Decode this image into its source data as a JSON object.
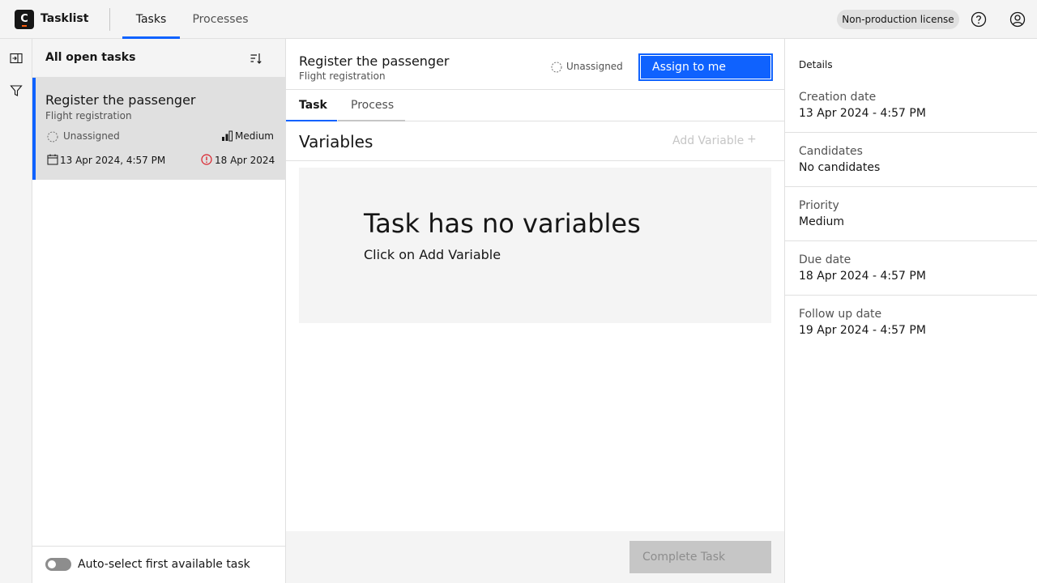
{
  "header": {
    "logo_letter": "C",
    "app_title": "Tasklist",
    "nav": [
      "Tasks",
      "Processes"
    ],
    "license": "Non-production license",
    "accent_color": "#0f62fe"
  },
  "rail": {
    "icons": [
      "expand-panel-icon",
      "filter-icon"
    ]
  },
  "task_list": {
    "title": "All open tasks",
    "sort_icon": "sort-icon",
    "tasks": [
      {
        "name": "Register the passenger",
        "process": "Flight registration",
        "assignee": "Unassigned",
        "priority": "Medium",
        "created": "13 Apr 2024, 4:57 PM",
        "due": "18 Apr 2024"
      }
    ],
    "auto_select_label": "Auto-select first available task",
    "auto_select_on": false
  },
  "task": {
    "name": "Register the passenger",
    "process": "Flight registration",
    "assignee": "Unassigned",
    "assign_label": "Assign to me",
    "tabs": [
      "Task",
      "Process"
    ],
    "active_tab": "Task",
    "variables_title": "Variables",
    "add_variable_label": "Add Variable",
    "add_variable_plus": "+",
    "empty_title": "Task has no variables",
    "empty_subtitle": "Click on Add Variable",
    "complete_label": "Complete Task"
  },
  "details": {
    "title": "Details",
    "rows": [
      {
        "label": "Creation date",
        "value": "13 Apr 2024 - 4:57 PM"
      },
      {
        "label": "Candidates",
        "value": "No candidates"
      },
      {
        "label": "Priority",
        "value": "Medium"
      },
      {
        "label": "Due date",
        "value": "18 Apr 2024 - 4:57 PM"
      },
      {
        "label": "Follow up date",
        "value": "19 Apr 2024 - 4:57 PM"
      }
    ]
  }
}
